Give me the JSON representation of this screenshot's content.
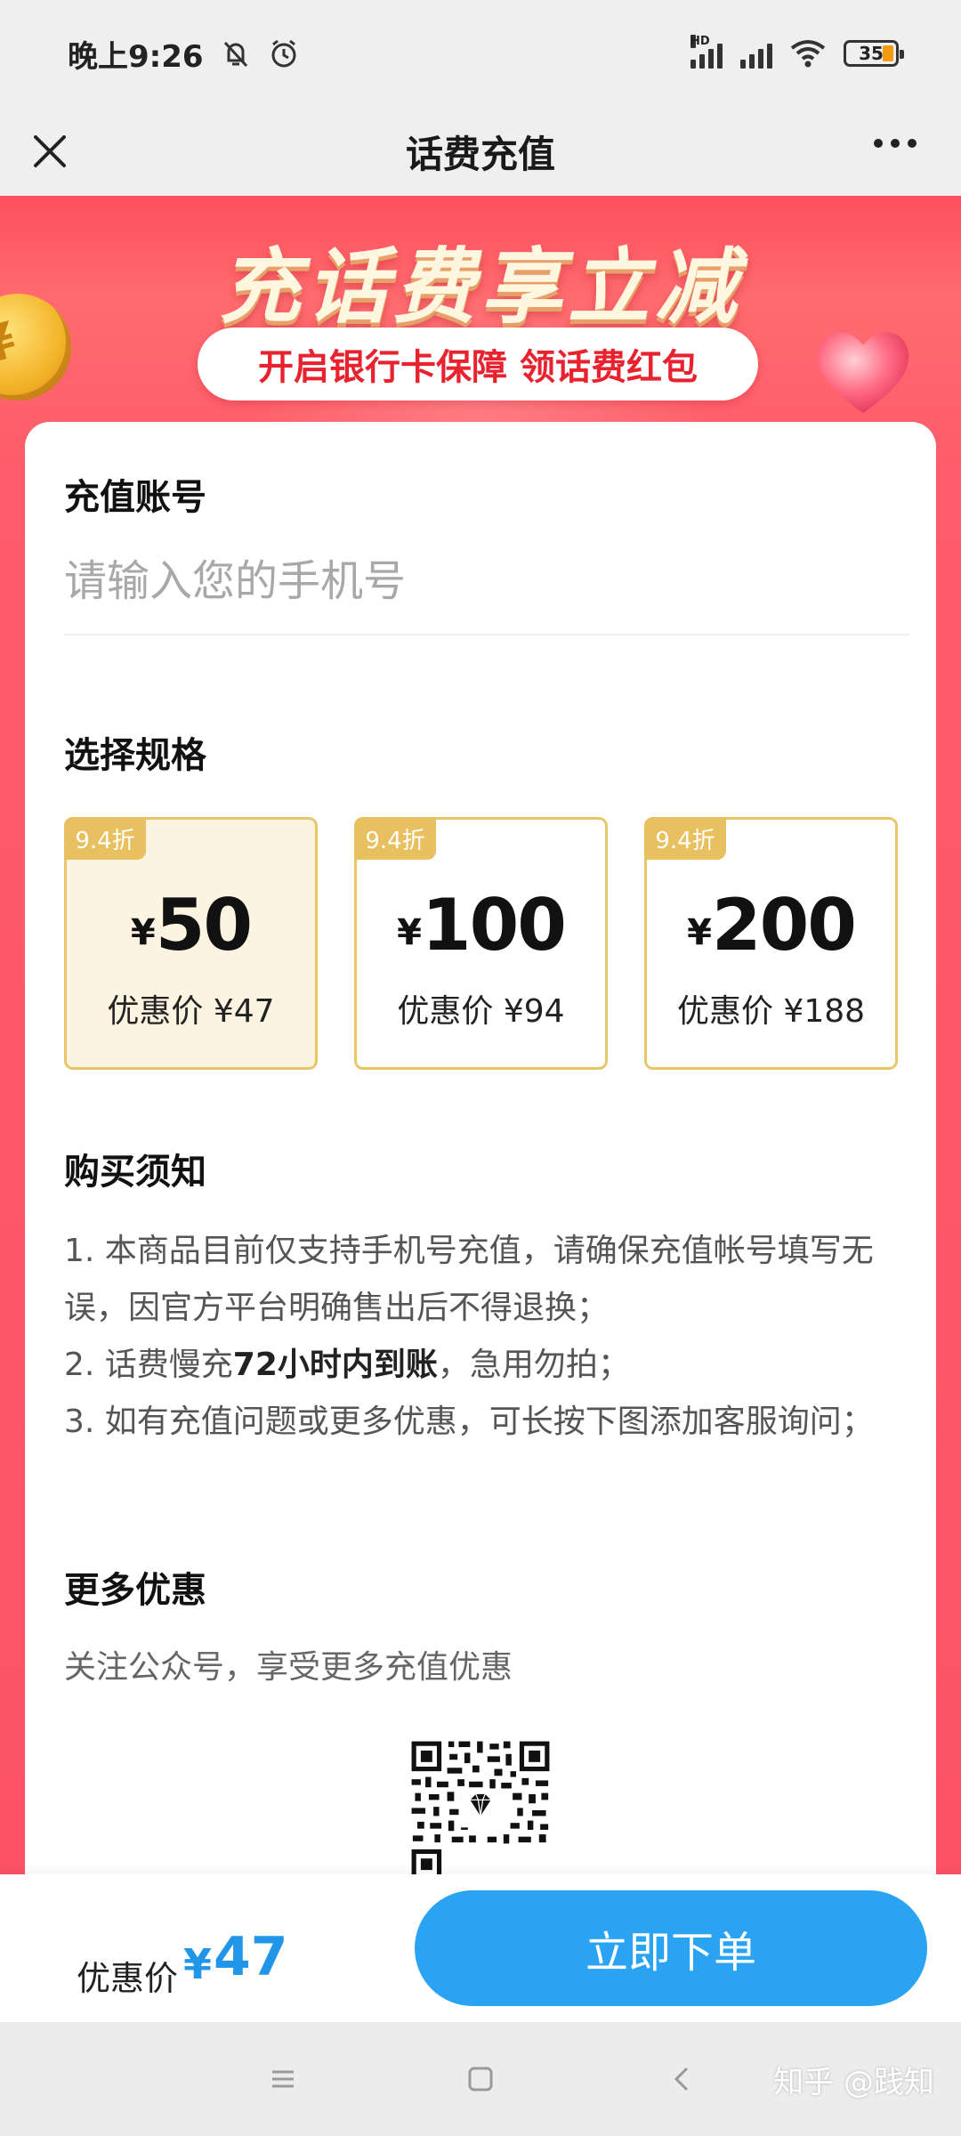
{
  "status": {
    "time": "晚上9:26",
    "battery": "35",
    "network_label": "HD"
  },
  "header": {
    "title": "话费充值"
  },
  "banner": {
    "title": "充话费享立减",
    "subtitle": "开启银行卡保障 领话费红包"
  },
  "account": {
    "section_title": "充值账号",
    "placeholder": "请输入您的手机号"
  },
  "specs": {
    "section_title": "选择规格",
    "currency": "¥",
    "items": [
      {
        "tag": "9.4折",
        "amount": "50",
        "price": "优惠价 ¥47",
        "selected": true
      },
      {
        "tag": "9.4折",
        "amount": "100",
        "price": "优惠价 ¥94",
        "selected": false
      },
      {
        "tag": "9.4折",
        "amount": "200",
        "price": "优惠价 ¥188",
        "selected": false
      }
    ]
  },
  "notice": {
    "section_title": "购买须知",
    "item1": "1. 本商品目前仅支持手机号充值，请确保充值帐号填写无误，因官方平台明确售出后不得退换；",
    "item2_prefix": "2. 话费慢充",
    "item2_bold": "72小时内到账",
    "item2_suffix": "，急用勿拍；",
    "item3": "3. 如有充值问题或更多优惠，可长按下图添加客服询问；"
  },
  "more": {
    "section_title": "更多优惠",
    "desc": "关注公众号，享受更多充值优惠"
  },
  "action": {
    "price_label": "优惠价",
    "currency": "¥",
    "price_value": "47",
    "order_button": "立即下单"
  },
  "watermark": "知乎 @践知",
  "colors": {
    "accent_blue": "#2aa3f3",
    "banner_red": "#fd5266",
    "tag_gold": "#e8c060"
  }
}
